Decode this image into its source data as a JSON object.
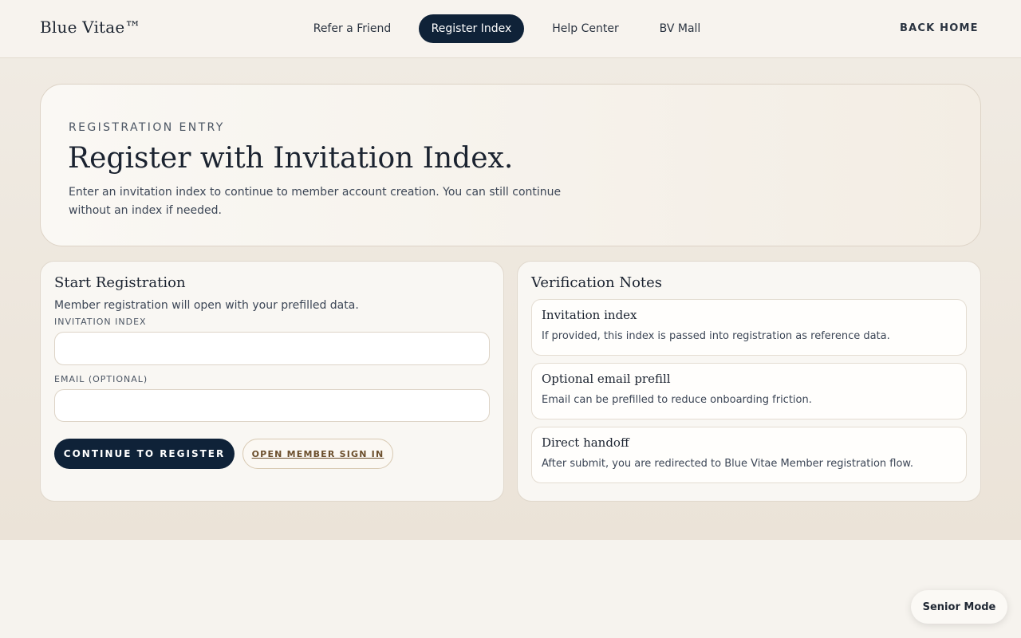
{
  "header": {
    "brand": "Blue Vitae™",
    "nav": [
      {
        "label": "Refer a Friend",
        "active": false
      },
      {
        "label": "Register Index",
        "active": true
      },
      {
        "label": "Help Center",
        "active": false
      },
      {
        "label": "BV Mall",
        "active": false
      }
    ],
    "back_home": "BACK HOME"
  },
  "hero": {
    "eyebrow": "REGISTRATION ENTRY",
    "title": "Register with Invitation Index.",
    "description": "Enter an invitation index to continue to member account creation. You can still continue without an index if needed."
  },
  "start_registration": {
    "title": "Start Registration",
    "subtitle": "Member registration will open with your prefilled data.",
    "invitation_label": "INVITATION INDEX",
    "invitation_value": "",
    "invitation_placeholder": "",
    "email_label": "EMAIL (OPTIONAL)",
    "email_value": "",
    "email_placeholder": "",
    "continue_label": "CONTINUE TO REGISTER",
    "sign_in_label": "OPEN MEMBER SIGN IN"
  },
  "verification": {
    "title": "Verification Notes",
    "notes": [
      {
        "title": "Invitation index",
        "body": "If provided, this index is passed into registration as reference data."
      },
      {
        "title": "Optional email prefill",
        "body": "Email can be prefilled to reduce onboarding friction."
      },
      {
        "title": "Direct handoff",
        "body": "After submit, you are redirected to Blue Vitae Member registration flow."
      }
    ]
  },
  "senior_mode": "Senior Mode",
  "colors": {
    "primary": "#0f2238",
    "background": "#f6f3ee",
    "accent_link": "#6b4e2c"
  }
}
